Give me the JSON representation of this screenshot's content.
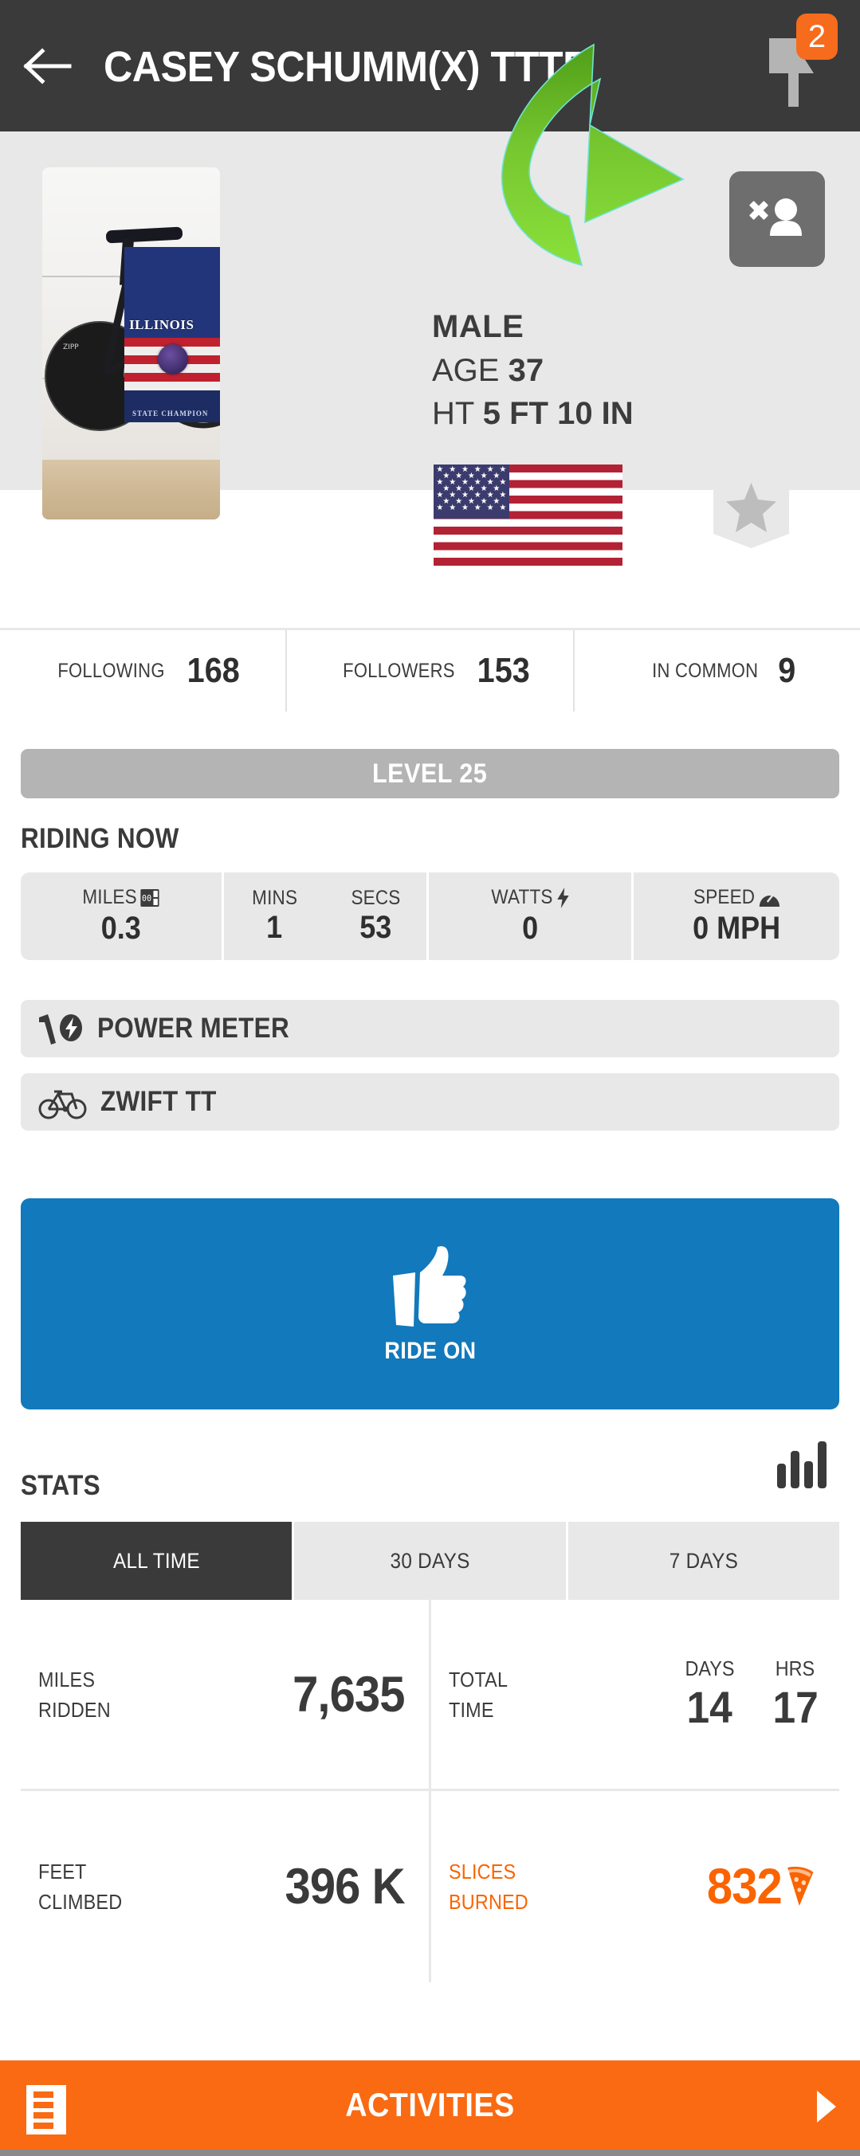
{
  "header": {
    "title": "CASEY SCHUMM(X) TTTF",
    "back_icon": "back-arrow-icon",
    "flag_icon": "flag-icon",
    "notification_count": "2",
    "notification_color": "#F76B1C"
  },
  "profile": {
    "photo_alt": "bike-photo",
    "unfollow_icon": "remove-user-icon",
    "badge_icon": "star-badge-icon",
    "annotation_icon": "green-curved-arrow",
    "gender": "MALE",
    "age_label": "AGE",
    "age_value": "37",
    "height_label": "HT",
    "height_value": "5 FT 10 IN",
    "country_flag": "us-flag-icon"
  },
  "counts": [
    {
      "label": "FOLLOWING",
      "value": "168"
    },
    {
      "label": "FOLLOWERS",
      "value": "153"
    },
    {
      "label": "IN COMMON",
      "value": "9"
    }
  ],
  "level": {
    "text": "LEVEL 25"
  },
  "riding_now": {
    "heading": "RIDING NOW",
    "miles": {
      "label": "MILES",
      "icon": "odometer-icon",
      "value": "0.3"
    },
    "mins": {
      "label": "MINS",
      "value": "1"
    },
    "secs": {
      "label": "SECS",
      "value": "53"
    },
    "watts": {
      "label": "WATTS",
      "icon": "lightning-icon",
      "value": "0"
    },
    "speed": {
      "label": "SPEED",
      "icon": "speedometer-icon",
      "value": "0 MPH"
    }
  },
  "equipment": [
    {
      "label": "POWER METER",
      "icon": "power-meter-icon"
    },
    {
      "label": "ZWIFT TT",
      "icon": "bicycle-icon"
    }
  ],
  "ride_on": {
    "label": "RIDE ON",
    "icon": "thumbs-up-icon",
    "color": "#1179BC"
  },
  "stats": {
    "heading": "STATS",
    "icon": "bar-chart-icon",
    "tabs": [
      {
        "label": "ALL TIME",
        "active": true
      },
      {
        "label": "30 DAYS",
        "active": false
      },
      {
        "label": "7 DAYS",
        "active": false
      }
    ],
    "miles_ridden": {
      "label_line1": "MILES",
      "label_line2": "RIDDEN",
      "value": "7,635"
    },
    "total_time": {
      "label_line1": "TOTAL",
      "label_line2": "TIME",
      "days_label": "DAYS",
      "days_value": "14",
      "hrs_label": "HRS",
      "hrs_value": "17"
    },
    "feet_climbed": {
      "label_line1": "FEET",
      "label_line2": "CLIMBED",
      "value": "396 K"
    },
    "slices_burned": {
      "label_line1": "SLICES",
      "label_line2": "BURNED",
      "value": "832",
      "icon": "pizza-slice-icon",
      "color": "#FA6400"
    }
  },
  "activities": {
    "label": "ACTIVITIES",
    "list_icon": "list-icon",
    "chevron_icon": "chevron-right-icon",
    "color": "#F96A12"
  }
}
